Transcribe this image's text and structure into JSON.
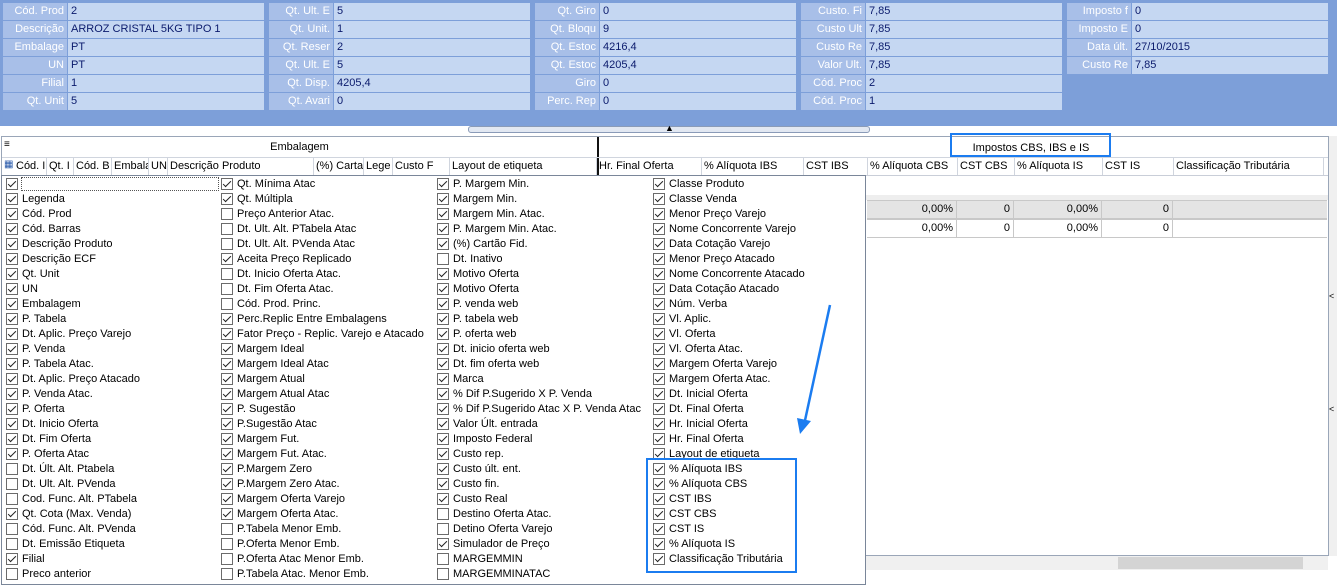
{
  "info_panel": {
    "groups": [
      {
        "rows": [
          {
            "label": "Cód. Prod",
            "value": "2"
          },
          {
            "label": "Descrição",
            "value": "ARROZ CRISTAL 5KG TIPO 1"
          },
          {
            "label": "Embalage",
            "value": "PT"
          },
          {
            "label": "UN",
            "value": "PT"
          },
          {
            "label": "Filial",
            "value": "1"
          },
          {
            "label": "Qt. Unit",
            "value": "5"
          }
        ]
      },
      {
        "rows": [
          {
            "label": "Qt. Ult. E",
            "value": "5"
          },
          {
            "label": "Qt. Unit.",
            "value": "1"
          },
          {
            "label": "Qt. Reser",
            "value": "2"
          },
          {
            "label": "Qt. Ult. E",
            "value": "5"
          },
          {
            "label": "Qt. Disp.",
            "value": "4205,4"
          },
          {
            "label": "Qt. Avari",
            "value": "0"
          }
        ]
      },
      {
        "rows": [
          {
            "label": "Qt. Giro",
            "value": "0"
          },
          {
            "label": "Qt. Bloqu",
            "value": "9"
          },
          {
            "label": "Qt. Estoc",
            "value": "4216,4"
          },
          {
            "label": "Qt. Estoc",
            "value": "4205,4"
          },
          {
            "label": "Giro",
            "value": "0"
          },
          {
            "label": "Perc. Rep",
            "value": "0"
          }
        ]
      },
      {
        "rows": [
          {
            "label": "Custo. Fi",
            "value": "7,85"
          },
          {
            "label": "Custo Ult",
            "value": "7,85"
          },
          {
            "label": "Custo Re",
            "value": "7,85"
          },
          {
            "label": "Valor Ult.",
            "value": "7,85"
          },
          {
            "label": "Cód. Proc",
            "value": "2"
          },
          {
            "label": "Cód. Proc",
            "value": "1"
          }
        ]
      },
      {
        "rows": [
          {
            "label": "Imposto f",
            "value": "0"
          },
          {
            "label": "Imposto E",
            "value": "0"
          },
          {
            "label": "Data últ.",
            "value": "27/10/2015"
          },
          {
            "label": "Custo Re",
            "value": "7,85"
          }
        ]
      }
    ]
  },
  "grid": {
    "band_embalagem": "Embalagem",
    "band_impostos": "Impostos CBS, IBS e IS",
    "columns": [
      "Cód. I",
      "Qt. I",
      "Cód. B",
      "Embala",
      "UN",
      "Descrição Produto",
      "(%) Carta",
      "Lege",
      "Custo F",
      "Layout de etiqueta",
      "Hr. Final Oferta",
      "% Alíquota IBS",
      "CST IBS",
      "% Alíquota CBS",
      "CST CBS",
      "% Alíquota IS",
      "CST IS",
      "Classificação Tributária"
    ],
    "rows": [
      {
        "aliq_cbs": "0,00%",
        "cst_cbs": "0",
        "aliq_is": "0,00%",
        "cst_is": "0"
      },
      {
        "aliq_cbs": "0,00%",
        "cst_cbs": "0",
        "aliq_is": "0,00%",
        "cst_is": "0"
      }
    ]
  },
  "column_chooser": {
    "columns": [
      [
        {
          "label": "",
          "checked": true
        },
        {
          "label": "Legenda",
          "checked": true
        },
        {
          "label": "Cód. Prod",
          "checked": true
        },
        {
          "label": "Cód. Barras",
          "checked": true
        },
        {
          "label": "Descrição Produto",
          "checked": true
        },
        {
          "label": "Descrição ECF",
          "checked": true
        },
        {
          "label": "Qt. Unit",
          "checked": true
        },
        {
          "label": "UN",
          "checked": true
        },
        {
          "label": "Embalagem",
          "checked": true
        },
        {
          "label": "P. Tabela",
          "checked": true
        },
        {
          "label": "Dt. Aplic. Preço Varejo",
          "checked": true
        },
        {
          "label": "P. Venda",
          "checked": true
        },
        {
          "label": "P. Tabela Atac.",
          "checked": true
        },
        {
          "label": "Dt. Aplic. Preço Atacado",
          "checked": true
        },
        {
          "label": "P. Venda Atac.",
          "checked": true
        },
        {
          "label": "P. Oferta",
          "checked": true
        },
        {
          "label": "Dt. Inicio Oferta",
          "checked": true
        },
        {
          "label": "Dt. Fim Oferta",
          "checked": true
        },
        {
          "label": "P. Oferta Atac",
          "checked": true
        },
        {
          "label": "Dt. Últ. Alt. Ptabela",
          "checked": false
        },
        {
          "label": "Dt. Ult. Alt. PVenda",
          "checked": false
        },
        {
          "label": "Cod. Func. Alt. PTabela",
          "checked": false
        },
        {
          "label": "Qt. Cota (Max. Venda)",
          "checked": true
        },
        {
          "label": "Cód. Func. Alt. PVenda",
          "checked": false
        },
        {
          "label": "Dt. Emissão Etiqueta",
          "checked": false
        },
        {
          "label": "Filial",
          "checked": true
        },
        {
          "label": "Preco anterior",
          "checked": false
        }
      ],
      [
        {
          "label": "Qt. Mínima Atac",
          "checked": true
        },
        {
          "label": "Qt. Múltipla",
          "checked": true
        },
        {
          "label": "Preço Anterior Atac.",
          "checked": false
        },
        {
          "label": "Dt. Ult. Alt. PTabela Atac",
          "checked": false
        },
        {
          "label": "Dt. Ult. Alt. PVenda Atac",
          "checked": false
        },
        {
          "label": "Aceita Preço Replicado",
          "checked": true
        },
        {
          "label": "Dt. Inicio Oferta Atac.",
          "checked": false
        },
        {
          "label": "Dt. Fim Oferta Atac.",
          "checked": false
        },
        {
          "label": "Cód. Prod. Princ.",
          "checked": false
        },
        {
          "label": "Perc.Replic Entre Embalagens",
          "checked": true
        },
        {
          "label": "Fator Preço - Replic. Varejo e Atacado",
          "checked": true
        },
        {
          "label": "Margem Ideal",
          "checked": true
        },
        {
          "label": "Margem Ideal Atac",
          "checked": true
        },
        {
          "label": "Margem Atual",
          "checked": true
        },
        {
          "label": "Margem Atual Atac",
          "checked": true
        },
        {
          "label": "P. Sugestão",
          "checked": true
        },
        {
          "label": "P.Sugestão Atac",
          "checked": true
        },
        {
          "label": "Margem Fut.",
          "checked": true
        },
        {
          "label": "Margem Fut. Atac.",
          "checked": true
        },
        {
          "label": "P.Margem Zero",
          "checked": true
        },
        {
          "label": "P.Margem Zero Atac.",
          "checked": true
        },
        {
          "label": "Margem Oferta Varejo",
          "checked": true
        },
        {
          "label": "Margem Oferta Atac.",
          "checked": true
        },
        {
          "label": "P.Tabela Menor Emb.",
          "checked": false
        },
        {
          "label": "P.Oferta Menor Emb.",
          "checked": false
        },
        {
          "label": "P.Oferta Atac Menor Emb.",
          "checked": false
        },
        {
          "label": "P.Tabela Atac. Menor Emb.",
          "checked": false
        }
      ],
      [
        {
          "label": "P. Margem Min.",
          "checked": true
        },
        {
          "label": "Margem Min.",
          "checked": true
        },
        {
          "label": "Margem Min. Atac.",
          "checked": true
        },
        {
          "label": "P. Margem Min. Atac.",
          "checked": true
        },
        {
          "label": "(%) Cartão Fid.",
          "checked": true
        },
        {
          "label": "Dt. Inativo",
          "checked": false
        },
        {
          "label": "Motivo Oferta",
          "checked": true
        },
        {
          "label": "Motivo Oferta",
          "checked": true
        },
        {
          "label": "P. venda web",
          "checked": true
        },
        {
          "label": "P. tabela web",
          "checked": true
        },
        {
          "label": "P. oferta web",
          "checked": true
        },
        {
          "label": "Dt. inicio oferta web",
          "checked": true
        },
        {
          "label": "Dt. fim oferta web",
          "checked": true
        },
        {
          "label": "Marca",
          "checked": true
        },
        {
          "label": "% Dif P.Sugerido X P. Venda",
          "checked": true
        },
        {
          "label": "% Dif P.Sugerido Atac X P. Venda Atac",
          "checked": true
        },
        {
          "label": "Valor Últ. entrada",
          "checked": true
        },
        {
          "label": "Imposto Federal",
          "checked": true
        },
        {
          "label": "Custo rep.",
          "checked": true
        },
        {
          "label": "Custo últ. ent.",
          "checked": true
        },
        {
          "label": "Custo fin.",
          "checked": true
        },
        {
          "label": "Custo Real",
          "checked": true
        },
        {
          "label": "Destino Oferta Atac.",
          "checked": false
        },
        {
          "label": "Detino Oferta Varejo",
          "checked": false
        },
        {
          "label": "Simulador de Preço",
          "checked": true
        },
        {
          "label": "MARGEMMIN",
          "checked": false
        },
        {
          "label": "MARGEMMINATAC",
          "checked": false
        }
      ],
      [
        {
          "label": "Classe Produto",
          "checked": true
        },
        {
          "label": "Classe Venda",
          "checked": true
        },
        {
          "label": "Menor Preço Varejo",
          "checked": true
        },
        {
          "label": "Nome Concorrente Varejo",
          "checked": true
        },
        {
          "label": "Data Cotação Varejo",
          "checked": true
        },
        {
          "label": "Menor Preço Atacado",
          "checked": true
        },
        {
          "label": "Nome Concorrente Atacado",
          "checked": true
        },
        {
          "label": "Data Cotação Atacado",
          "checked": true
        },
        {
          "label": "Núm. Verba",
          "checked": true
        },
        {
          "label": "Vl. Aplic.",
          "checked": true
        },
        {
          "label": "Vl. Oferta",
          "checked": true
        },
        {
          "label": "Vl. Oferta Atac.",
          "checked": true
        },
        {
          "label": "Margem Oferta Varejo",
          "checked": true
        },
        {
          "label": "Margem Oferta Atac.",
          "checked": true
        },
        {
          "label": "Dt. Inicial Oferta",
          "checked": true
        },
        {
          "label": "Dt. Final Oferta",
          "checked": true
        },
        {
          "label": "Hr. Inicial Oferta",
          "checked": true
        },
        {
          "label": "Hr. Final Oferta",
          "checked": true
        },
        {
          "label": "Layout de etiqueta",
          "checked": true
        },
        {
          "label": "% Alíquota IBS",
          "checked": true
        },
        {
          "label": "% Alíquota CBS",
          "checked": true
        },
        {
          "label": "CST IBS",
          "checked": true
        },
        {
          "label": "CST CBS",
          "checked": true
        },
        {
          "label": "CST IS",
          "checked": true
        },
        {
          "label": "% Alíquota IS",
          "checked": true
        },
        {
          "label": "Classificação Tributária",
          "checked": true
        }
      ]
    ]
  },
  "colors": {
    "panel_bg": "#7d9fd9",
    "label_bg": "#a8bfe8",
    "value_bg": "#c5d7f2",
    "highlight": "#1b7cf0"
  }
}
